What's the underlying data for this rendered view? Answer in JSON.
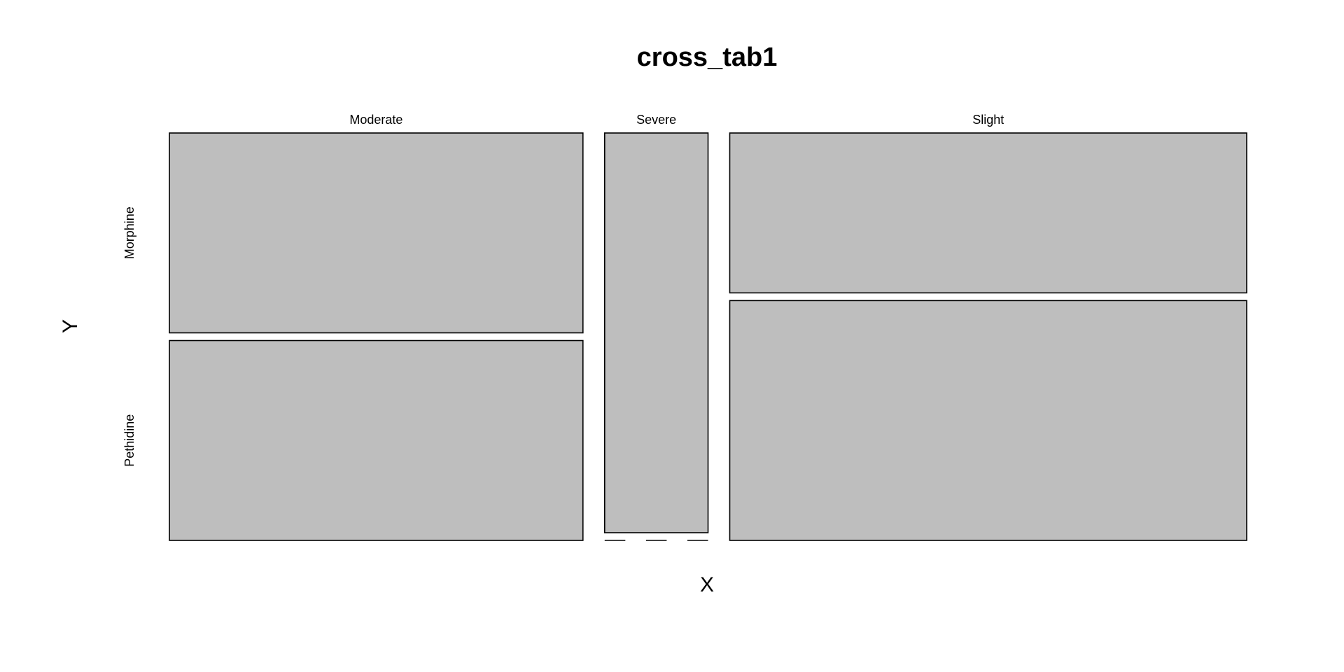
{
  "chart_data": {
    "type": "mosaic",
    "title": "cross_tab1",
    "xlabel": "X",
    "ylabel": "Y",
    "x_categories": [
      "Moderate",
      "Severe",
      "Slight"
    ],
    "y_categories": [
      "Morphine",
      "Pethidine"
    ],
    "x_proportions": [
      0.4,
      0.1,
      0.5
    ],
    "cell_proportions": [
      [
        0.5,
        0.5
      ],
      [
        1.0,
        0.0
      ],
      [
        0.4,
        0.6
      ]
    ],
    "fill_color": "#bebebe",
    "stroke_color": "#000000"
  }
}
